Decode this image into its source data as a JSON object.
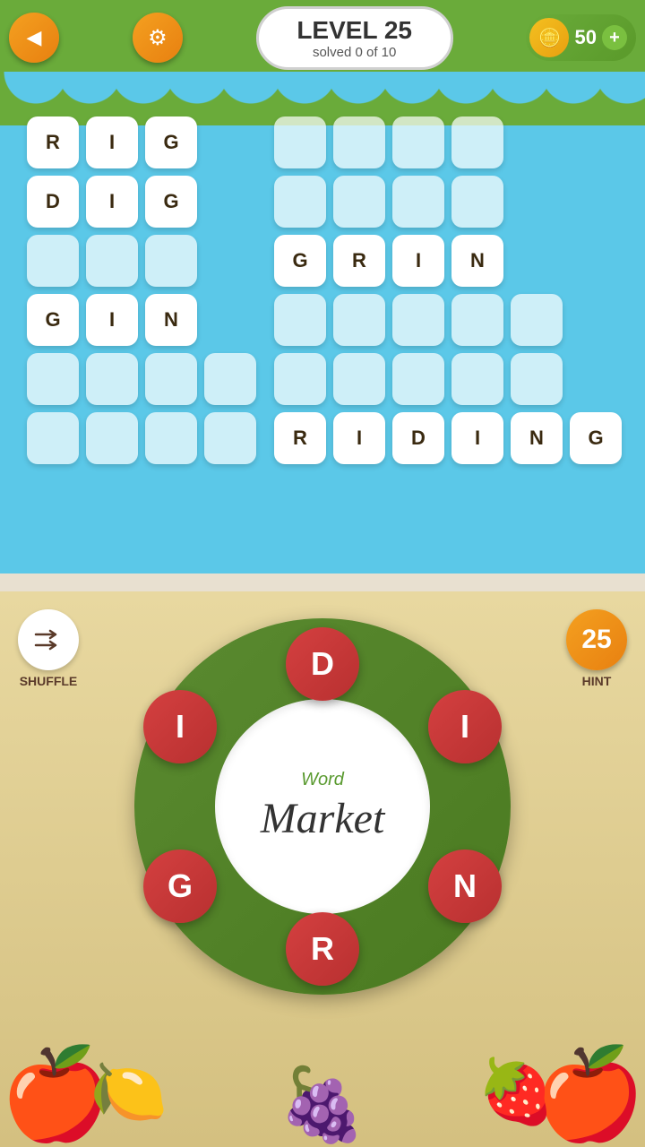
{
  "header": {
    "level_label": "LEVEL 25",
    "solved_label": "solved 0 of 10",
    "coin_count": "50",
    "back_label": "◀",
    "settings_label": "⚙",
    "add_label": "+"
  },
  "grid": {
    "left_words": [
      [
        "R",
        "I",
        "G"
      ],
      [
        "D",
        "I",
        "G"
      ],
      [
        "",
        "",
        ""
      ],
      [
        "G",
        "I",
        "N"
      ],
      [
        "",
        "",
        "",
        ""
      ],
      [
        "",
        "",
        "",
        ""
      ]
    ],
    "right_words": [
      [
        "",
        "",
        "",
        ""
      ],
      [
        "",
        "",
        "",
        ""
      ],
      [
        "G",
        "R",
        "I",
        "N"
      ],
      [
        "",
        "",
        "",
        "",
        ""
      ],
      [
        "",
        "",
        "",
        "",
        ""
      ],
      [
        "R",
        "I",
        "D",
        "I",
        "N",
        "G"
      ]
    ]
  },
  "wheel": {
    "word_small": "Word",
    "word_large": "Market",
    "letters": [
      "D",
      "I",
      "G",
      "R",
      "N",
      "I"
    ],
    "hint_count": "25",
    "shuffle_label": "SHUFFLE",
    "hint_label": "HINT"
  }
}
